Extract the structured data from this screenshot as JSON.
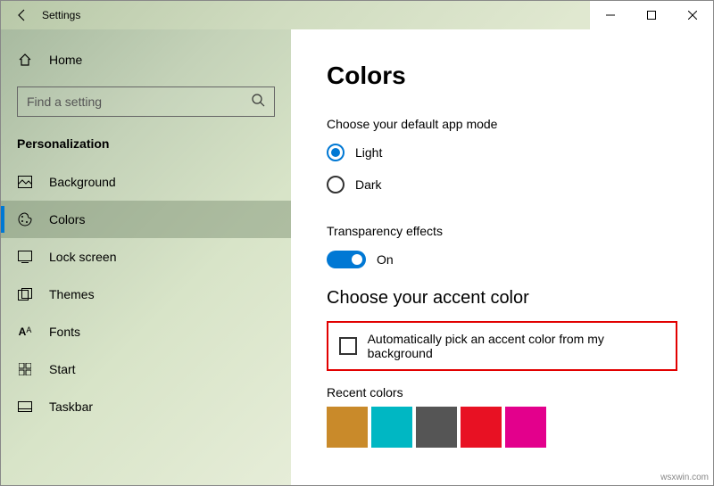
{
  "titlebar": {
    "title": "Settings"
  },
  "sidebar": {
    "home": "Home",
    "search_placeholder": "Find a setting",
    "category": "Personalization",
    "items": [
      {
        "label": "Background"
      },
      {
        "label": "Colors"
      },
      {
        "label": "Lock screen"
      },
      {
        "label": "Themes"
      },
      {
        "label": "Fonts"
      },
      {
        "label": "Start"
      },
      {
        "label": "Taskbar"
      }
    ]
  },
  "main": {
    "heading": "Colors",
    "mode_label": "Choose your default app mode",
    "mode_light": "Light",
    "mode_dark": "Dark",
    "transparency_label": "Transparency effects",
    "transparency_state": "On",
    "accent_label": "Choose your accent color",
    "auto_accent_label": "Automatically pick an accent color from my background",
    "recent_label": "Recent colors",
    "recent_colors": [
      "#c98a2a",
      "#00b7c3",
      "#555555",
      "#e81123",
      "#e3008c"
    ]
  },
  "watermark": "wsxwin.com"
}
